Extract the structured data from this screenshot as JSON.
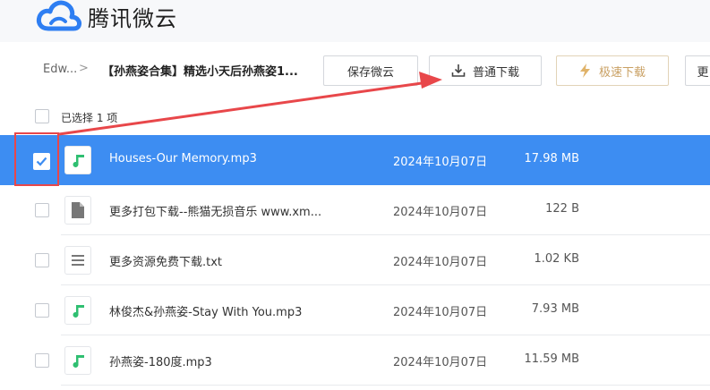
{
  "app": {
    "name": "腾讯微云"
  },
  "breadcrumb": {
    "root": "Edw...",
    "sep": ">",
    "current": "【孙燕姿合集】精选小天后孙燕姿1..."
  },
  "toolbar": {
    "save_label": "保存微云",
    "normal_download_label": "普通下载",
    "fast_download_label": "极速下载",
    "more_label": "更"
  },
  "selection": {
    "text": "已选择 1 项"
  },
  "colors": {
    "selected_row": "#3d8df2",
    "annotation": "#e8474a",
    "music_icon": "#2fbf71"
  },
  "files": [
    {
      "name": "Houses-Our Memory.mp3",
      "date": "2024年10月07日",
      "size": "17.98 MB",
      "icon": "music-file-icon",
      "selected": true
    },
    {
      "name": "更多打包下载--熊猫无损音乐 www.xm...",
      "date": "2024年10月07日",
      "size": "122 B",
      "icon": "generic-file-icon",
      "selected": false
    },
    {
      "name": "更多资源免费下载.txt",
      "date": "2024年10月07日",
      "size": "1.02 KB",
      "icon": "text-file-icon",
      "selected": false
    },
    {
      "name": "林俊杰&孙燕姿-Stay With You.mp3",
      "date": "2024年10月07日",
      "size": "7.93 MB",
      "icon": "music-file-icon",
      "selected": false
    },
    {
      "name": "孙燕姿-180度.mp3",
      "date": "2024年10月07日",
      "size": "11.59 MB",
      "icon": "music-file-icon",
      "selected": false
    }
  ]
}
